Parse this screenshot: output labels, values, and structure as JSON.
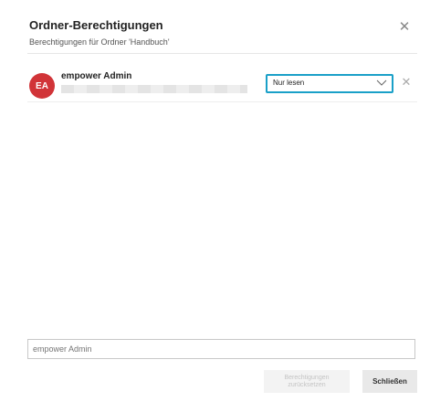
{
  "dialog": {
    "title": "Ordner-Berechtigungen",
    "subtitle": "Berechtigungen für Ordner 'Handbuch'",
    "close_icon": "close-icon"
  },
  "permissions": [
    {
      "initials": "EA",
      "name": "empower Admin",
      "role": "Nur lesen",
      "avatar_color": "#d13438"
    }
  ],
  "add_user": {
    "placeholder": "empower Admin"
  },
  "footer": {
    "reset_label": "Berechtigungen zurücksetzen",
    "close_label": "Schließen"
  },
  "colors": {
    "focus_border": "#1aa0c8"
  }
}
